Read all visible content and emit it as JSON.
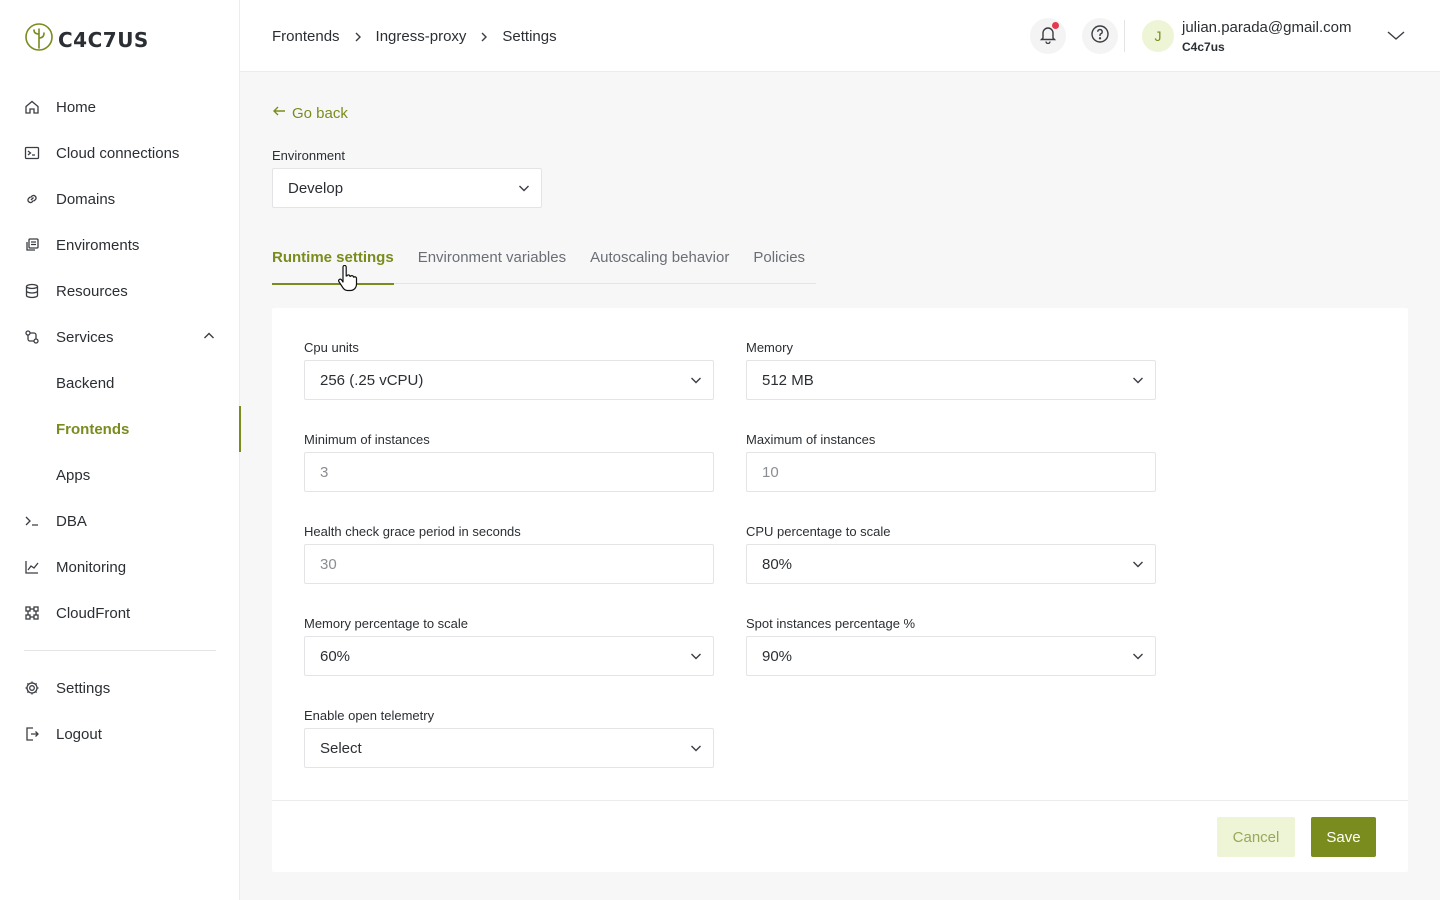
{
  "brand": {
    "logo_text": "C4C7US"
  },
  "sidebar": {
    "items": [
      {
        "label": "Home",
        "icon": "home-icon"
      },
      {
        "label": "Cloud connections",
        "icon": "terminal-window-icon"
      },
      {
        "label": "Domains",
        "icon": "link-icon"
      },
      {
        "label": "Enviroments",
        "icon": "environments-icon"
      },
      {
        "label": "Resources",
        "icon": "database-icon"
      },
      {
        "label": "Services",
        "icon": "services-icon",
        "expanded": true
      },
      {
        "label": "Backend"
      },
      {
        "label": "Frontends",
        "active": true
      },
      {
        "label": "Apps"
      },
      {
        "label": "DBA",
        "icon": "prompt-icon"
      },
      {
        "label": "Monitoring",
        "icon": "chart-line-icon"
      },
      {
        "label": "CloudFront",
        "icon": "cloudfront-icon"
      }
    ],
    "bottom_items": [
      {
        "label": "Settings",
        "icon": "gear-icon"
      },
      {
        "label": "Logout",
        "icon": "logout-icon"
      }
    ]
  },
  "header": {
    "breadcrumb": [
      "Frontends",
      "Ingress-proxy",
      "Settings"
    ],
    "user": {
      "initial": "J",
      "email": "julian.parada@gmail.com",
      "org": "C4c7us"
    }
  },
  "main": {
    "go_back": "Go back",
    "environment": {
      "label": "Environment",
      "value": "Develop"
    },
    "tabs": [
      {
        "label": "Runtime settings",
        "active": true
      },
      {
        "label": "Environment variables"
      },
      {
        "label": "Autoscaling behavior"
      },
      {
        "label": "Policies"
      }
    ],
    "form": {
      "cpu_units": {
        "label": "Cpu units",
        "value": "256 (.25 vCPU)"
      },
      "memory": {
        "label": "Memory",
        "value": "512 MB"
      },
      "min_instances": {
        "label": "Minimum of instances",
        "placeholder": "3"
      },
      "max_instances": {
        "label": "Maximum of instances",
        "placeholder": "10"
      },
      "health_check": {
        "label": "Health check grace period in seconds",
        "placeholder": "30"
      },
      "cpu_scale": {
        "label": "CPU percentage to scale",
        "value": "80%"
      },
      "memory_scale": {
        "label": "Memory percentage to scale",
        "value": "60%"
      },
      "spot_instances": {
        "label": "Spot instances percentage %",
        "value": "90%"
      },
      "telemetry": {
        "label": "Enable open telemetry",
        "value": "Select"
      }
    },
    "actions": {
      "cancel": "Cancel",
      "save": "Save"
    }
  },
  "colors": {
    "accent": "#7a8c1e",
    "accent_light": "#eef4d6",
    "notification": "#e53950"
  }
}
